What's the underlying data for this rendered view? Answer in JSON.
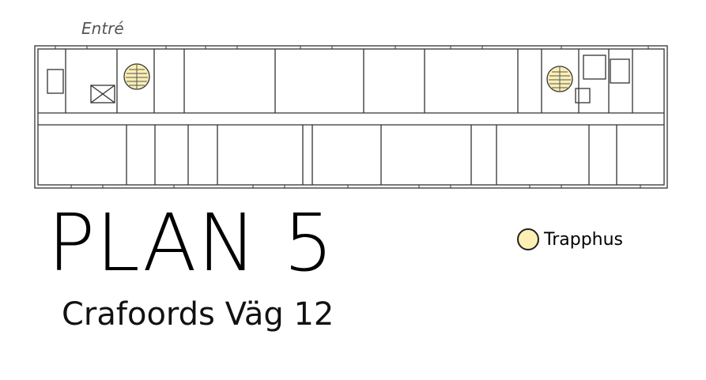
{
  "entrance_label": "Entré",
  "title": "PLAN 5",
  "subtitle": "Crafoords Väg 12",
  "legend": {
    "label": "Trapphus",
    "swatch_color": "#fcefb4"
  },
  "colors": {
    "stair_fill": "#fcefb4",
    "wall": "#333333"
  }
}
